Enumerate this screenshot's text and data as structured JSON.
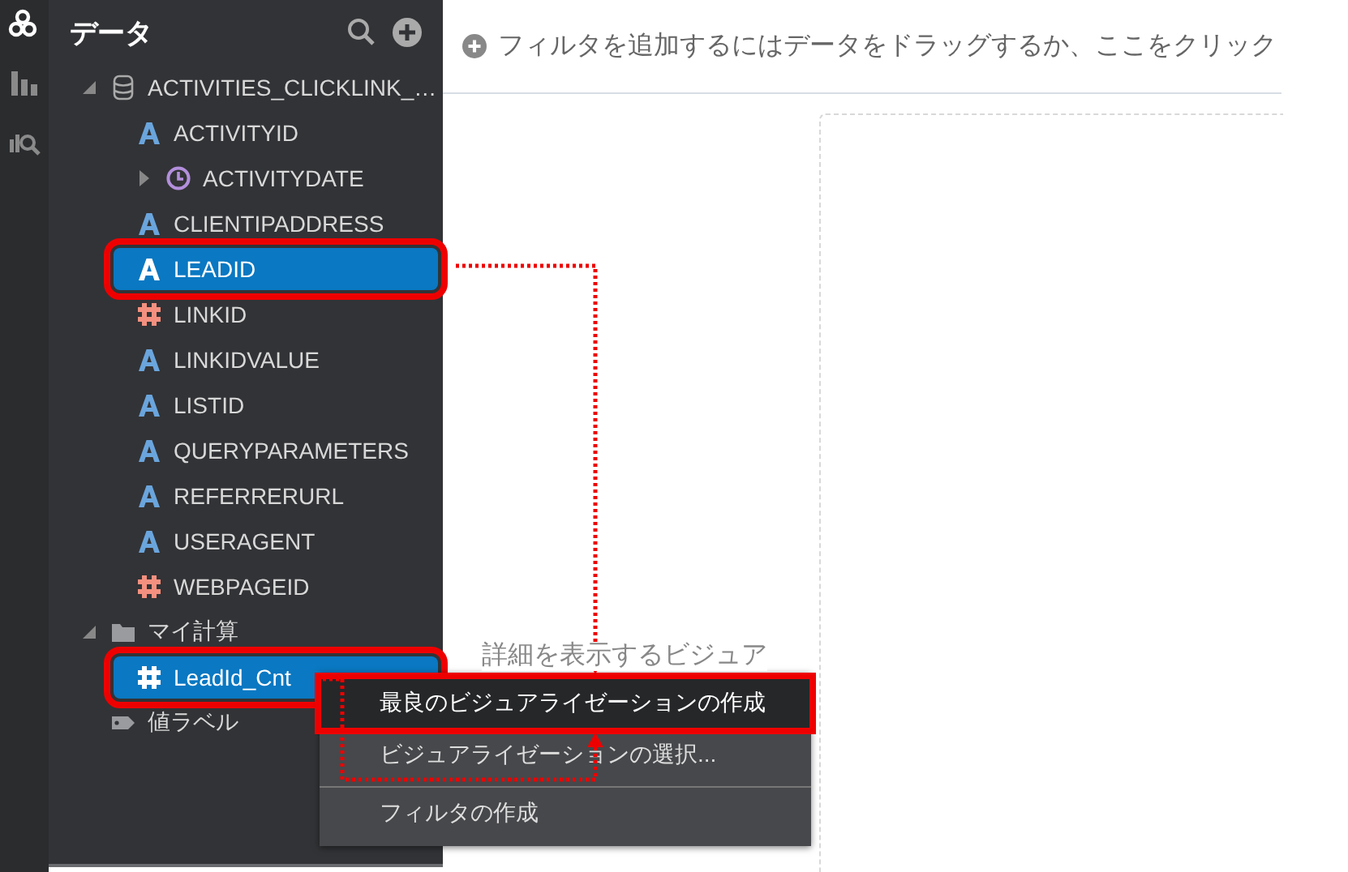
{
  "rail": {
    "items": [
      {
        "kind": "data",
        "selected": true
      },
      {
        "kind": "visualize",
        "selected": false
      },
      {
        "kind": "analytics",
        "selected": false
      }
    ]
  },
  "panel": {
    "title": "データ"
  },
  "tree": [
    {
      "label": "ACTIVITIES_CLICKLINK_…",
      "kind": "table",
      "expanded": true,
      "selected": false,
      "framed": false,
      "children": [
        {
          "label": "ACTIVITYID",
          "kind": "text",
          "selected": false,
          "framed": false
        },
        {
          "label": "ACTIVITYDATE",
          "kind": "date",
          "expanded": false,
          "selected": false,
          "framed": false
        },
        {
          "label": "CLIENTIPADDRESS",
          "kind": "text",
          "selected": false,
          "framed": false
        },
        {
          "label": "LEADID",
          "kind": "text",
          "selected": true,
          "framed": true
        },
        {
          "label": "LINKID",
          "kind": "number",
          "selected": false,
          "framed": false
        },
        {
          "label": "LINKIDVALUE",
          "kind": "text",
          "selected": false,
          "framed": false
        },
        {
          "label": "LISTID",
          "kind": "text",
          "selected": false,
          "framed": false
        },
        {
          "label": "QUERYPARAMETERS",
          "kind": "text",
          "selected": false,
          "framed": false
        },
        {
          "label": "REFERRERURL",
          "kind": "text",
          "selected": false,
          "framed": false
        },
        {
          "label": "USERAGENT",
          "kind": "text",
          "selected": false,
          "framed": false
        },
        {
          "label": "WEBPAGEID",
          "kind": "number",
          "selected": false,
          "framed": false
        }
      ]
    },
    {
      "label": "マイ計算",
      "kind": "folder",
      "expanded": true,
      "selected": false,
      "framed": false,
      "children": [
        {
          "label": "LeadId_Cnt",
          "kind": "number",
          "selected": true,
          "framed": true
        }
      ]
    },
    {
      "label": "値ラベル",
      "kind": "tag",
      "selected": false,
      "framed": false
    }
  ],
  "filter_bar": {
    "placeholder": "フィルタを追加するにはデータをドラッグするか、ここをクリック"
  },
  "canvas": {
    "hint": "詳細を表示するビジュア"
  },
  "context_menu": {
    "items": [
      {
        "label": "最良のビジュアライゼーションの作成",
        "selected": true,
        "framed": true
      },
      {
        "label": "ビジュアライゼーションの選択...",
        "selected": false,
        "framed": false
      },
      {
        "label": "フィルタの作成",
        "selected": false,
        "framed": false,
        "separator_before": true
      }
    ]
  }
}
